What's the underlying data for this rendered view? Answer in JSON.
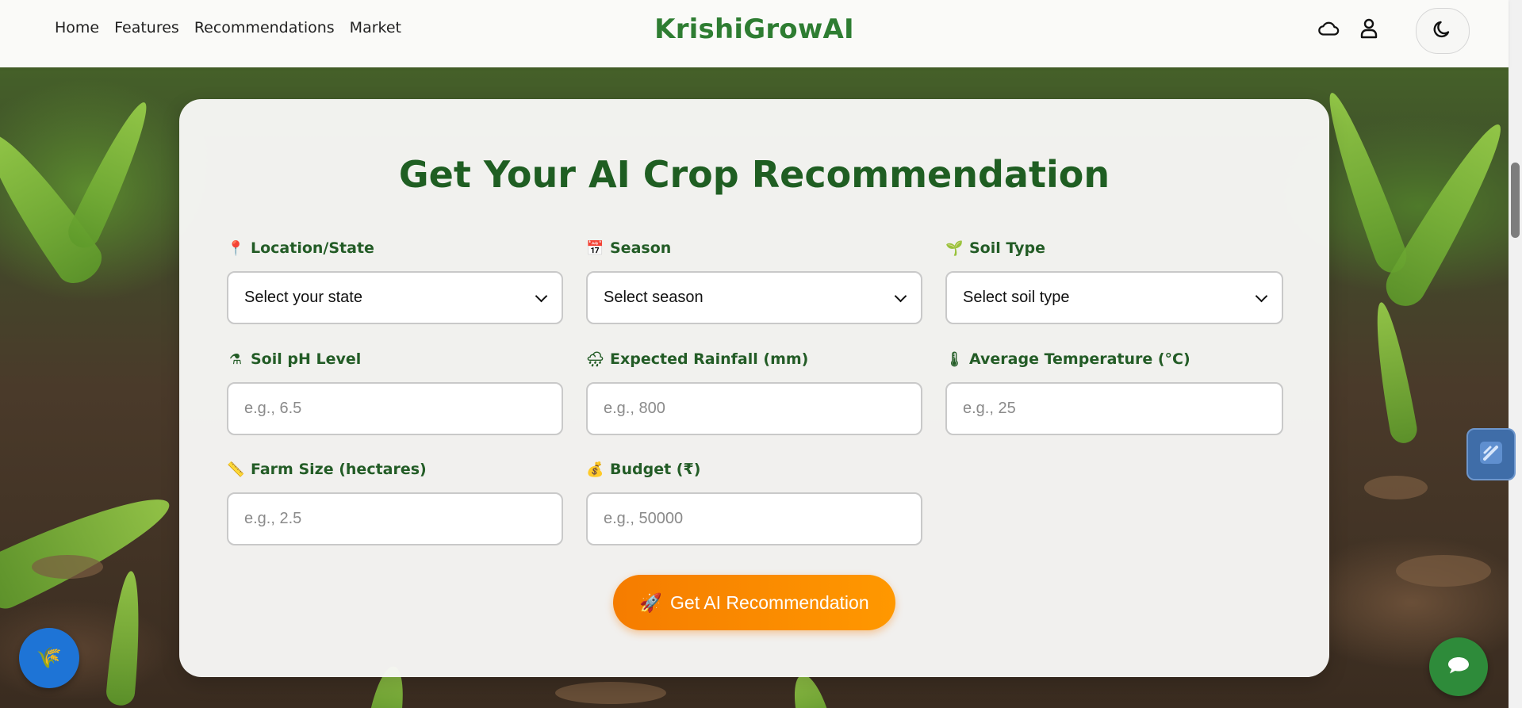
{
  "header": {
    "nav": [
      "Home",
      "Features",
      "Recommendations",
      "Market"
    ],
    "brand": "KrishiGrowAI",
    "icons": [
      "cloud-icon",
      "user-icon",
      "moon-icon"
    ]
  },
  "form": {
    "title": "Get Your AI Crop Recommendation",
    "fields": [
      {
        "label": "Location/State",
        "emoji": "📍",
        "type": "select",
        "value": "Select your state"
      },
      {
        "label": "Season",
        "emoji": "📅",
        "type": "select",
        "value": "Select season"
      },
      {
        "label": "Soil Type",
        "emoji": "🌱",
        "type": "select",
        "value": "Select soil type"
      },
      {
        "label": "Soil pH Level",
        "emoji": "⚗",
        "type": "input",
        "placeholder": "e.g., 6.5"
      },
      {
        "label": "Expected Rainfall (mm)",
        "emoji": "🌧",
        "type": "input",
        "placeholder": "e.g., 800"
      },
      {
        "label": "Average Temperature (°C)",
        "emoji": "🌡",
        "type": "input",
        "placeholder": "e.g., 25"
      },
      {
        "label": "Farm Size (hectares)",
        "emoji": "📏",
        "type": "input",
        "placeholder": "e.g., 2.5"
      },
      {
        "label": "Budget (₹)",
        "emoji": "💰",
        "type": "input",
        "placeholder": "e.g., 50000"
      }
    ],
    "submit_label": "Get AI Recommendation",
    "submit_emoji": "🚀"
  },
  "floating": {
    "left_icon": "🌾",
    "right_icon": "chat-icon"
  },
  "colors": {
    "brand": "#2e7d32",
    "title": "#1f5e22",
    "button": "#f57c00",
    "chat": "#2e8b3a",
    "fab": "#1e74d6"
  }
}
